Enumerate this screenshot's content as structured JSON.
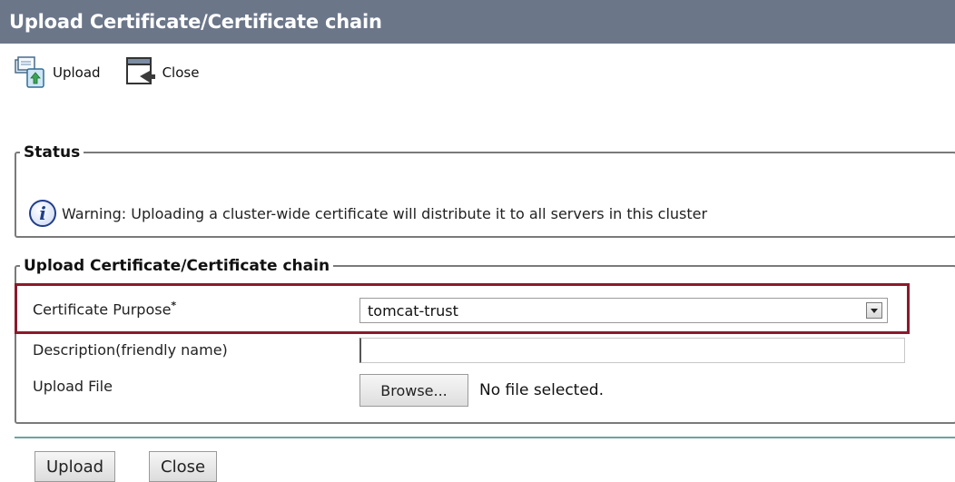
{
  "window": {
    "title": "Upload Certificate/Certificate chain"
  },
  "toolbar": {
    "upload_label": "Upload",
    "close_label": "Close"
  },
  "status": {
    "legend": "Status",
    "icon": "info-icon",
    "message": "Warning: Uploading a cluster-wide certificate will distribute it to all servers in this cluster"
  },
  "form": {
    "legend": "Upload Certificate/Certificate chain",
    "purpose_label": "Certificate Purpose",
    "required_mark": "*",
    "purpose_value": "tomcat-trust",
    "description_label": "Description(friendly name)",
    "description_value": "",
    "file_label": "Upload File",
    "browse_label": "Browse...",
    "file_status": "No file selected."
  },
  "buttons": {
    "upload_label": "Upload",
    "close_label": "Close"
  },
  "colors": {
    "titlebar": "#6b7689",
    "highlight": "#8b1a2b",
    "divider": "#6aa3a3"
  }
}
